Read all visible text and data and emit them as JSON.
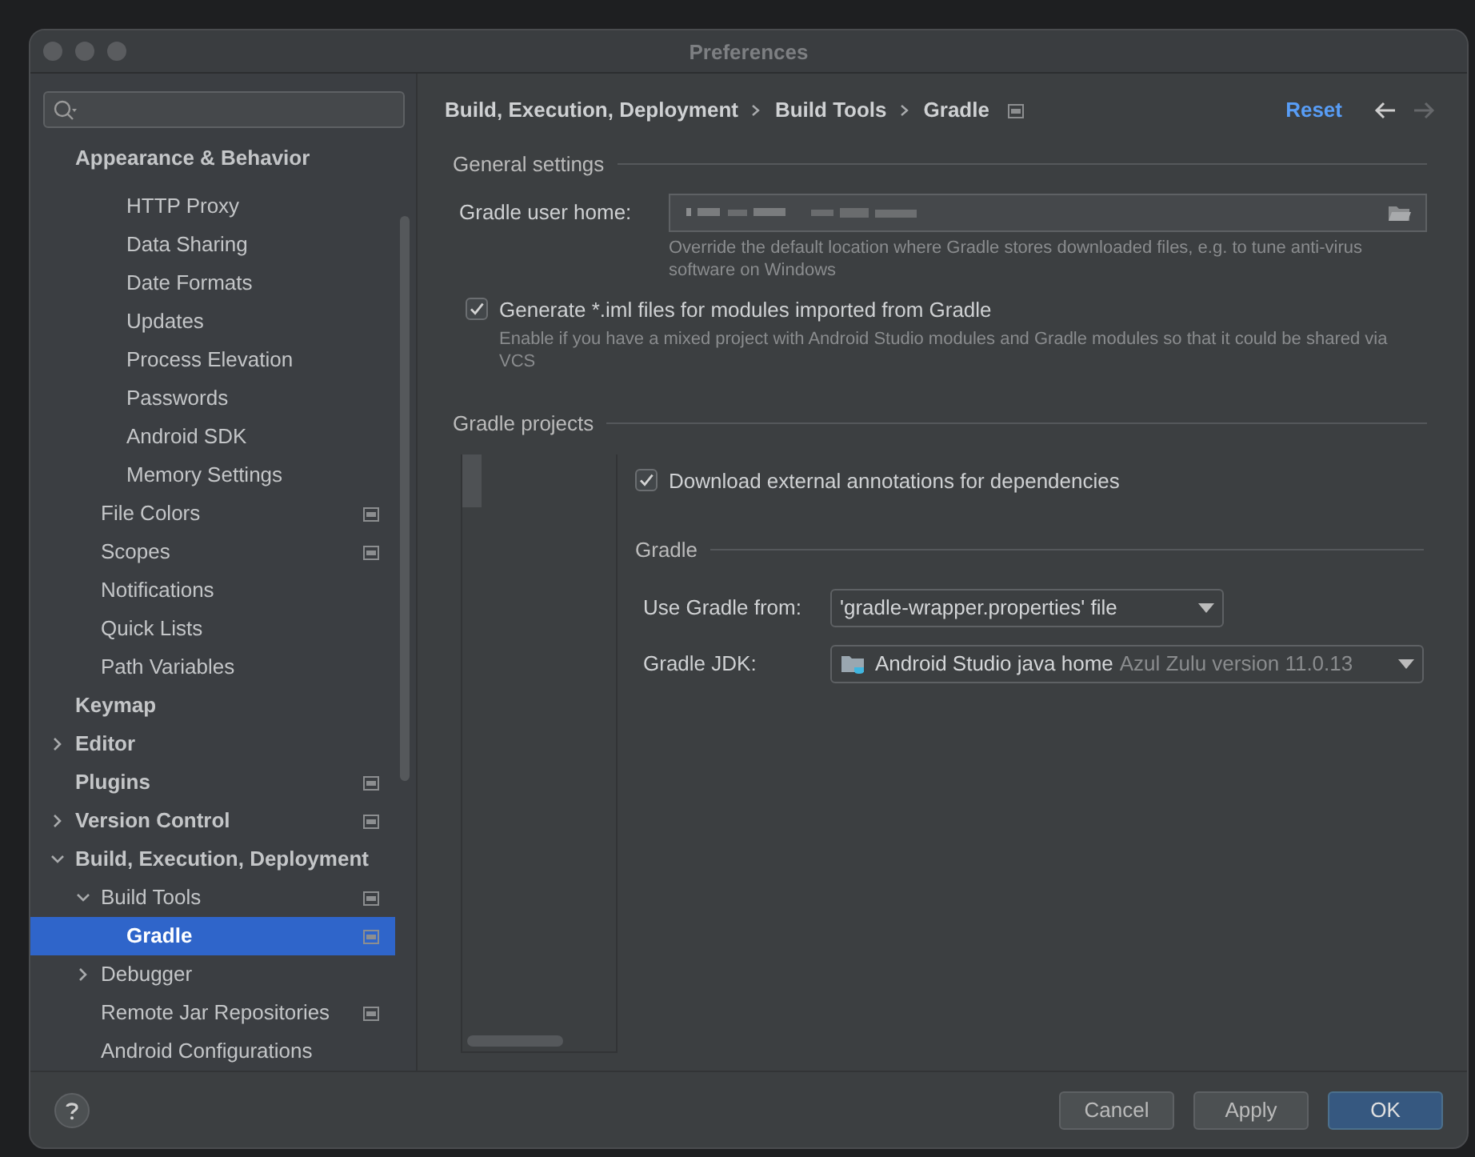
{
  "window": {
    "title": "Preferences"
  },
  "sidebar": {
    "items": [
      {
        "label": "Appearance & Behavior",
        "children": [
          {
            "children": [
              {
                "label": "HTTP Proxy"
              },
              {
                "label": "Data Sharing"
              },
              {
                "label": "Date Formats"
              },
              {
                "label": "Updates"
              },
              {
                "label": "Process Elevation"
              },
              {
                "label": "Passwords"
              },
              {
                "label": "Android SDK"
              },
              {
                "label": "Memory Settings"
              }
            ]
          },
          {
            "label": "File Colors",
            "project_level": true
          },
          {
            "label": "Scopes",
            "project_level": true
          },
          {
            "label": "Notifications"
          },
          {
            "label": "Quick Lists"
          },
          {
            "label": "Path Variables"
          }
        ]
      },
      {
        "label": "Keymap"
      },
      {
        "label": "Editor",
        "expanded": false
      },
      {
        "label": "Plugins",
        "project_level": true
      },
      {
        "label": "Version Control",
        "expanded": false,
        "project_level": true
      },
      {
        "label": "Build, Execution, Deployment",
        "expanded": true,
        "children": [
          {
            "label": "Build Tools",
            "expanded": true,
            "project_level": true,
            "children": [
              {
                "label": "Gradle",
                "project_level": true,
                "selected": true
              }
            ]
          },
          {
            "label": "Debugger",
            "expanded": false
          },
          {
            "label": "Remote Jar Repositories",
            "project_level": true
          },
          {
            "label": "Android Configurations"
          }
        ]
      }
    ]
  },
  "breadcrumb": [
    "Build, Execution, Deployment",
    "Build Tools",
    "Gradle"
  ],
  "reset": "Reset",
  "general_settings": {
    "title": "General settings",
    "user_home_label": "Gradle user home:",
    "user_home_hint": "Override the default location where Gradle stores downloaded files, e.g. to tune anti-virus software on Windows",
    "generate_iml": {
      "label": "Generate *.iml files for modules imported from Gradle",
      "checked": true,
      "hint": "Enable if you have a mixed project with Android Studio modules and Gradle modules so that it could be shared via VCS"
    }
  },
  "gradle_projects": {
    "title": "Gradle projects",
    "download_annotations": {
      "label": "Download external annotations for dependencies",
      "checked": true
    },
    "gradle": {
      "title": "Gradle",
      "use_from": {
        "label": "Use Gradle from:",
        "value": "'gradle-wrapper.properties' file"
      },
      "jdk": {
        "label": "Gradle JDK:",
        "value": "Android Studio java home",
        "detail": "Azul Zulu version 11.0.13"
      }
    }
  },
  "buttons": [
    {
      "label": "Cancel",
      "default": false
    },
    {
      "label": "Apply",
      "default": false
    },
    {
      "label": "OK",
      "default": true
    }
  ]
}
